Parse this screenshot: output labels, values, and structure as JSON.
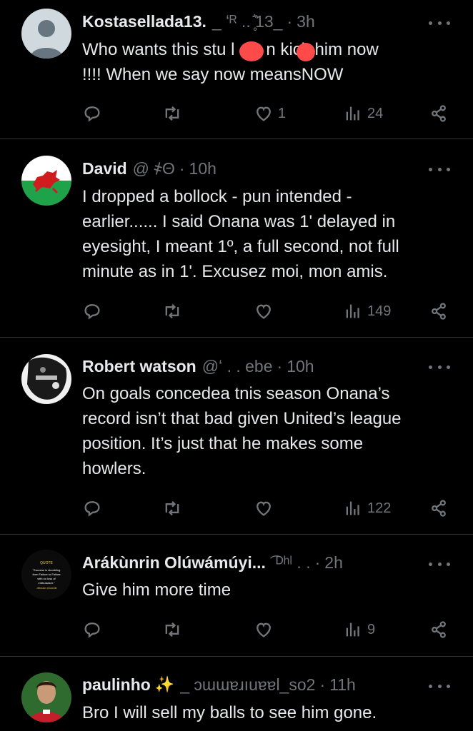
{
  "posts": [
    {
      "name": "Kostasellada13.",
      "handle": "_ ʻᴿ  ..  ̥҄͛13_",
      "time": "3h",
      "text": "Who wants this stu    l clo    n kick him now\n!!!! When we say now meansNOW",
      "replies": "",
      "retweets": "",
      "likes": "1",
      "views": "24",
      "avatar": "default-avatar"
    },
    {
      "name": "David",
      "handle": "@              ҂Θ",
      "time": "10h",
      "text": "I dropped a bollock - pun intended -\nearlier...... I said Onana was 1'  delayed in\neyesight,   I meant 1º,  a full second, not full\nminute as in 1'.   Excusez moi, mon amis.",
      "replies": "",
      "retweets": "",
      "likes": "",
      "views": "149",
      "avatar": "welsh-flag-avatar"
    },
    {
      "name": "Robert watson",
      "handle": "@ʻ       . .           ebe",
      "time": "10h",
      "text": "On goals concedea tnis season Onana’s\nrecord isn’t that bad given United’s league\nposition. It’s just that he makes some\nhowlers.",
      "replies": "",
      "retweets": "",
      "likes": "",
      "views": "122",
      "avatar": "photo-avatar"
    },
    {
      "name": "Arákùnrin Olúwámúyi...",
      "handle": "͡        ᴰʰˡ  . .",
      "time": "2h",
      "text": "Give him more time",
      "replies": "",
      "retweets": "",
      "likes": "",
      "views": "9",
      "avatar": "quote-avatar"
    },
    {
      "name": "paulinho",
      "handle": "_ ɔɯɯɐɹıuɐɐl_so2",
      "time": "11h",
      "text": "Bro I will sell my balls to see him gone.",
      "replies": "",
      "retweets": "",
      "likes": "",
      "views": "",
      "avatar": "player-avatar"
    }
  ],
  "avatar_quote_text": "QUOTE \"Success is stumbling from Failure to Failure with no loss of enthusiasm.\" -Winston Churchill",
  "colors": {
    "background": "#000000",
    "text": "#e7e9ea",
    "muted": "#71767b",
    "divider": "#2f3336",
    "redact": "#ff4a4a"
  },
  "icons": [
    "reply-icon",
    "retweet-icon",
    "like-icon",
    "views-icon",
    "share-icon",
    "more-icon"
  ]
}
